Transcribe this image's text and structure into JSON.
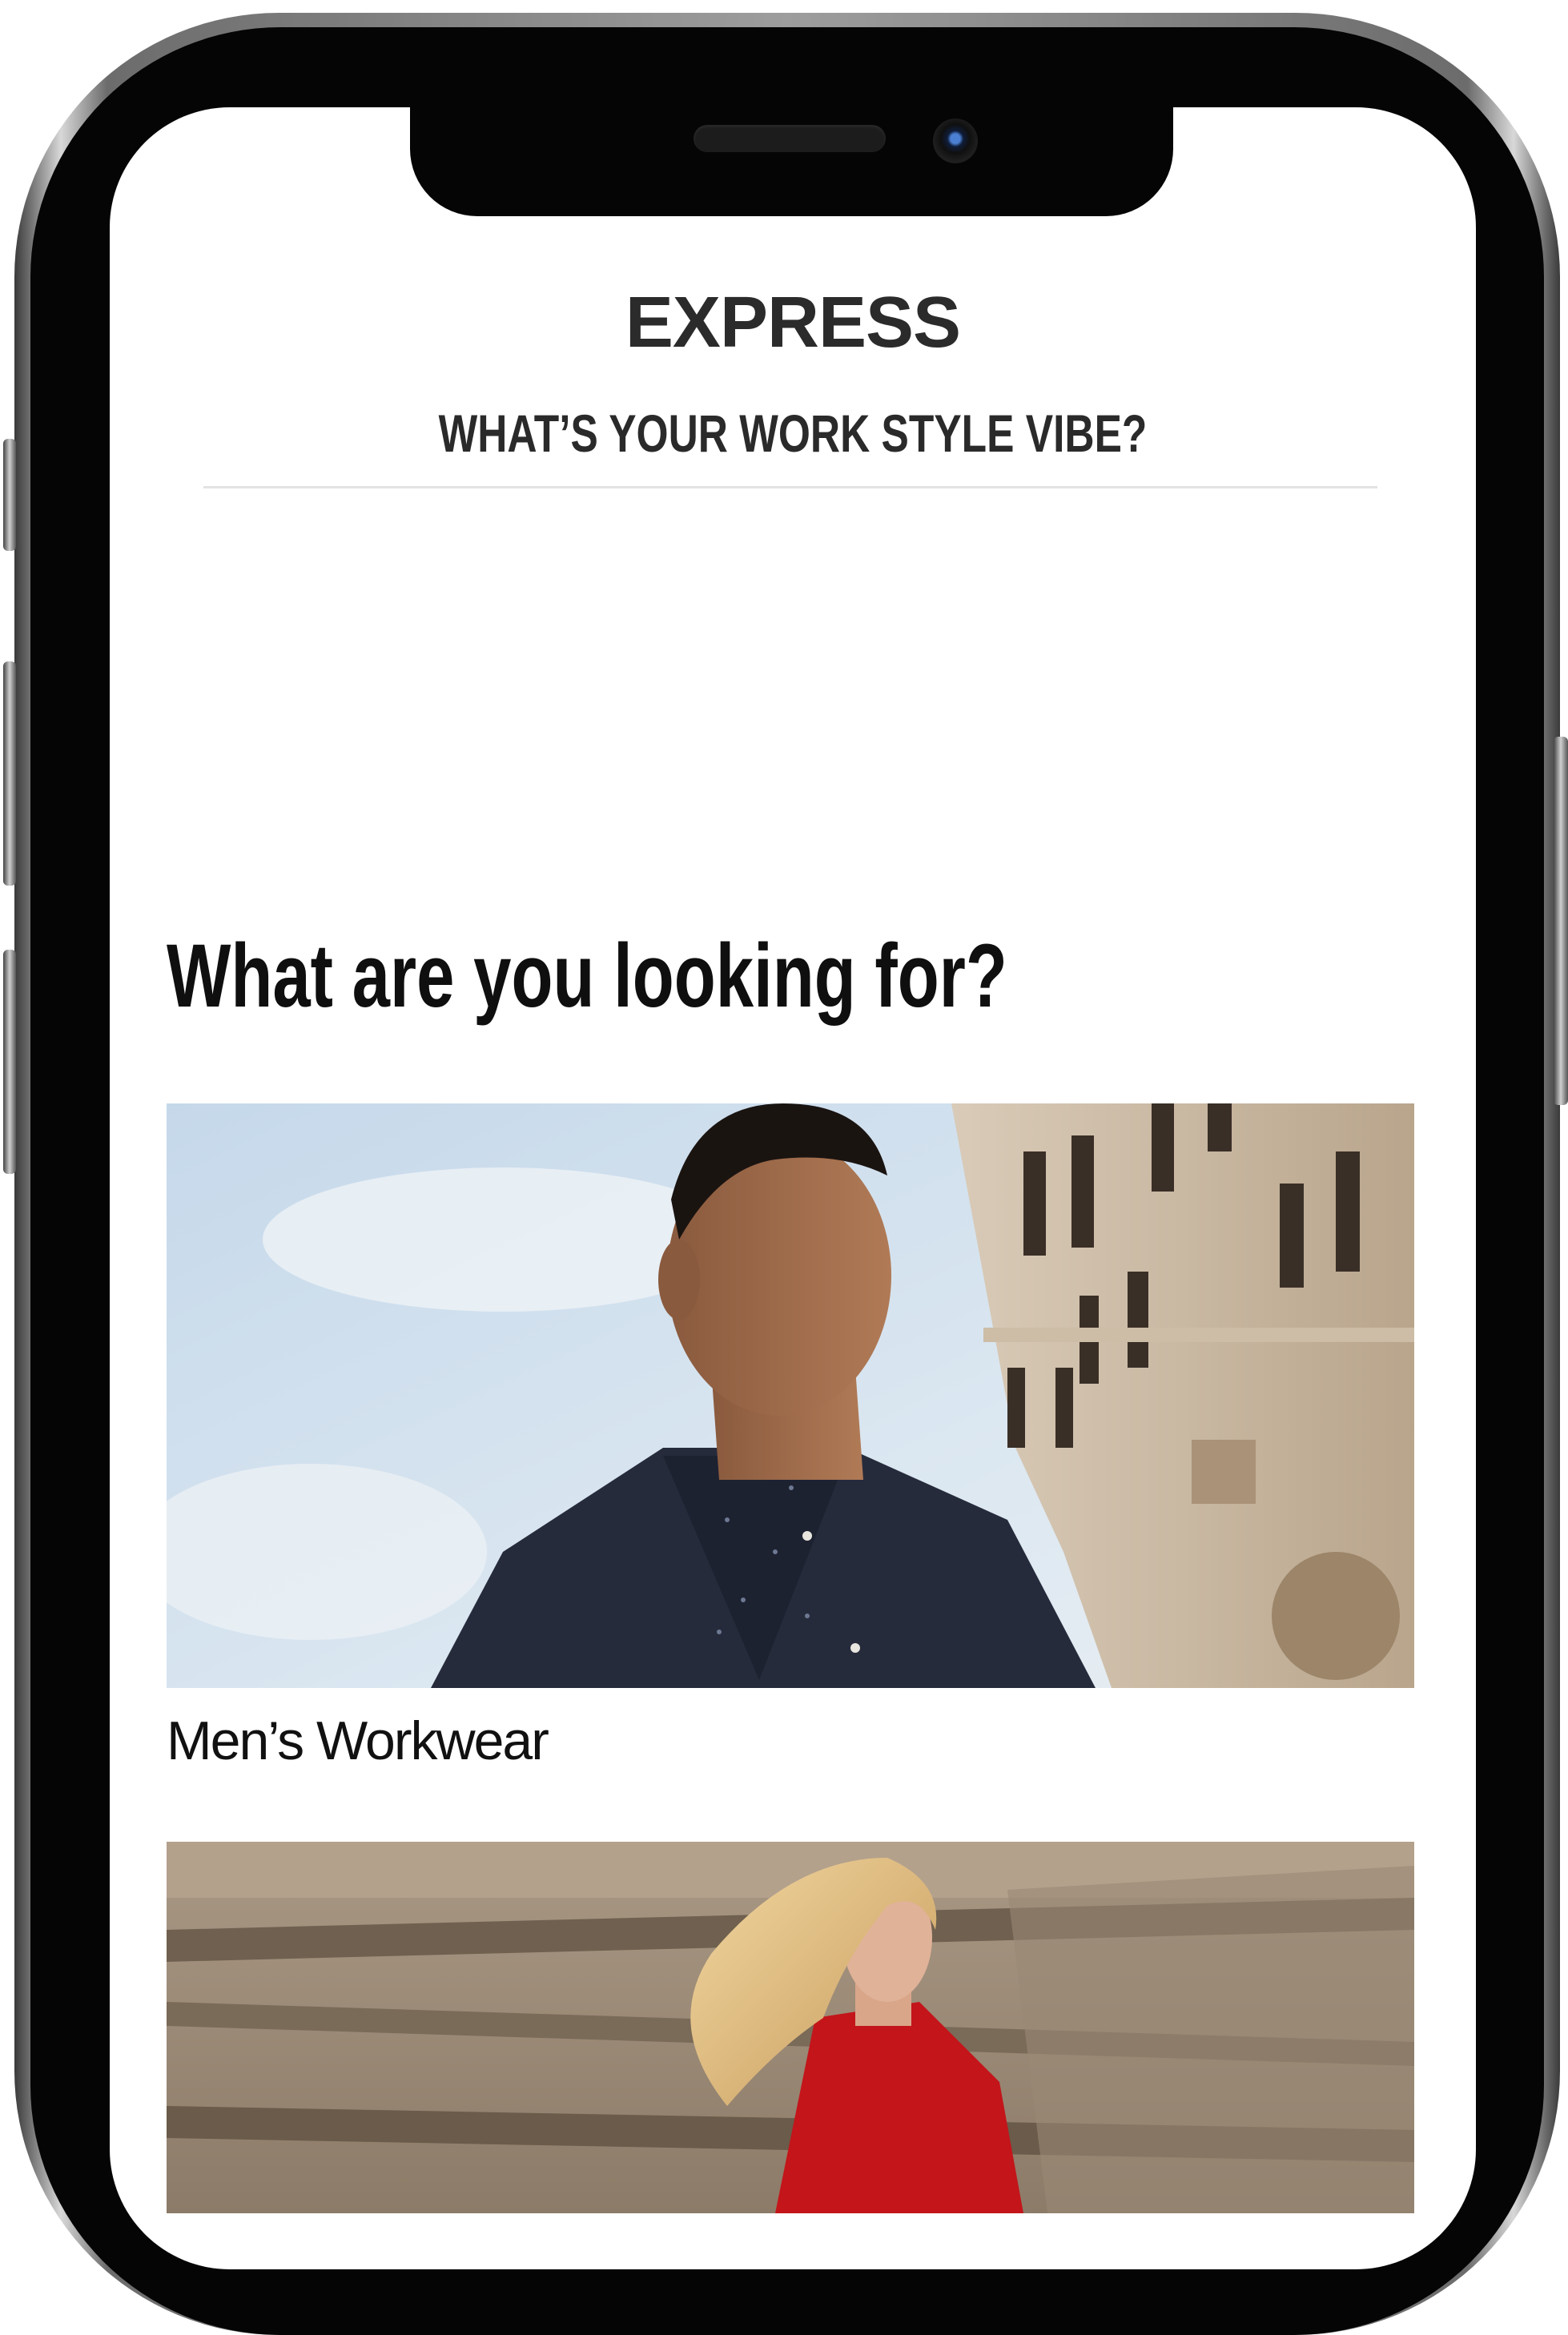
{
  "header": {
    "brand": "EXPRESS",
    "tagline": "WHAT’S YOUR WORK STYLE VIBE?"
  },
  "main": {
    "question": "What are you looking for?",
    "categories": [
      {
        "label": "Men’s Workwear",
        "image_icon": "mens-workwear-photo"
      },
      {
        "label": "",
        "image_icon": "womens-workwear-photo"
      }
    ]
  },
  "colors": {
    "brand_text": "#2b2b2b",
    "heading_text": "#0f0f0f",
    "divider": "#e3e3e3"
  }
}
